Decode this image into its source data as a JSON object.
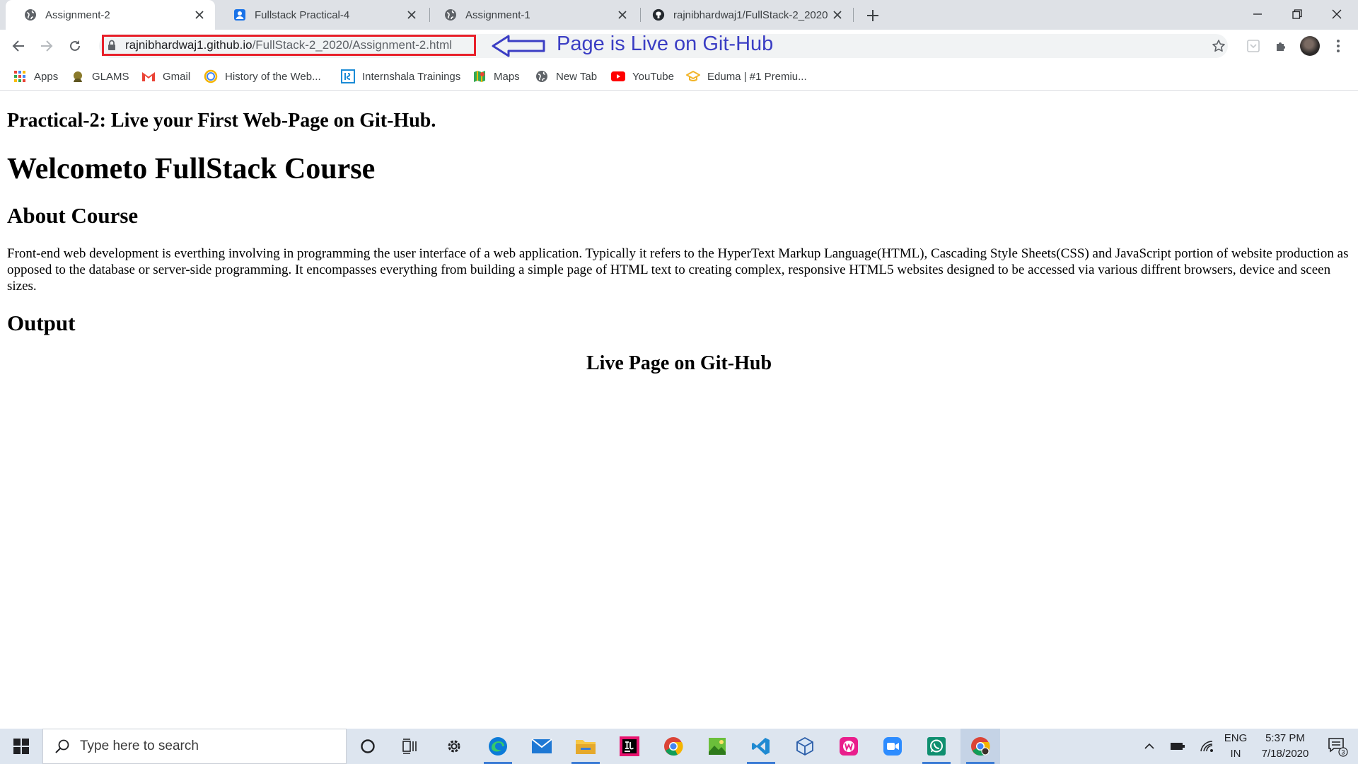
{
  "browser": {
    "tabs": [
      {
        "title": "Assignment-2",
        "icon": "globe-icon",
        "active": true
      },
      {
        "title": "Fullstack Practical-4",
        "icon": "classroom-icon",
        "active": false
      },
      {
        "title": "Assignment-1",
        "icon": "globe-icon",
        "active": false
      },
      {
        "title": "rajnibhardwaj1/FullStack-2_2020",
        "icon": "github-icon",
        "active": false
      }
    ],
    "address": {
      "host": "rajnibhardwaj1.github.io",
      "path": "/FullStack-2_2020/Assignment-2.html"
    },
    "annotation": "Page is Live on Git-Hub",
    "bookmarks": [
      {
        "label": "Apps",
        "icon": "apps-grid-icon"
      },
      {
        "label": "GLAMS",
        "icon": "glams-icon"
      },
      {
        "label": "Gmail",
        "icon": "gmail-icon"
      },
      {
        "label": "History of the Web...",
        "icon": "history-icon"
      },
      {
        "label": "Internshala Trainings",
        "icon": "internshala-icon"
      },
      {
        "label": "Maps",
        "icon": "maps-icon"
      },
      {
        "label": "New Tab",
        "icon": "globe-icon"
      },
      {
        "label": "YouTube",
        "icon": "youtube-icon"
      },
      {
        "label": "Eduma | #1 Premiu...",
        "icon": "eduma-icon"
      }
    ]
  },
  "content": {
    "practical_heading": "Practical-2: Live your First Web-Page on Git-Hub.",
    "welcome_heading": "Welcometo FullStack Course",
    "about_heading": "About Course",
    "about_text": "Front-end web development is everthing involving in programming the user interface of a web application. Typically it refers to the HyperText Markup Language(HTML), Cascading Style Sheets(CSS) and JavaScript portion of website production as opposed to the database or server-side programming. It encompasses everything from building a simple page of HTML text to creating complex, responsive HTML5 websites designed to be accessed via various diffrent browsers, device and sceen sizes.",
    "output_heading": "Output",
    "live_heading": "Live Page on Git-Hub"
  },
  "taskbar": {
    "search_placeholder": "Type here to search",
    "language_line1": "ENG",
    "language_line2": "IN",
    "time": "5:37 PM",
    "date": "7/18/2020",
    "notification_count": "3"
  },
  "colors": {
    "url_highlight": "#e8202a",
    "annotation": "#3b3ec4",
    "tabstrip_bg": "#dee1e6",
    "taskbar_bg": "#dde5ef"
  }
}
